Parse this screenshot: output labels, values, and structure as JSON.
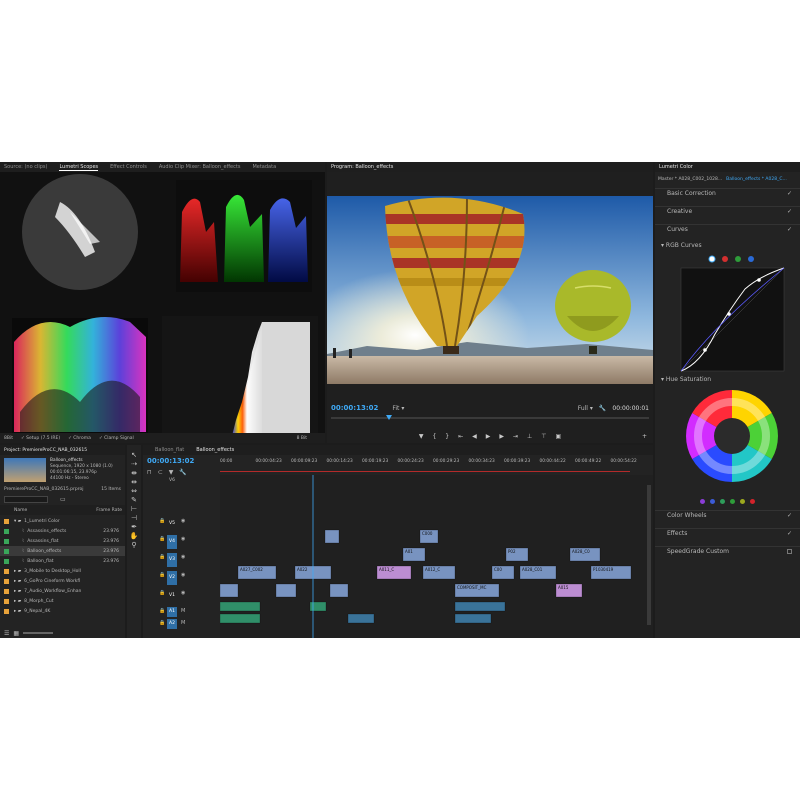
{
  "source_panel": {
    "tabs": [
      "Source: (no clips)",
      "Lumetri Scopes",
      "Effect Controls",
      "Audio Clip Mixer: Balloon_effects",
      "Metadata"
    ],
    "active_tab": "Lumetri Scopes",
    "bottom_bar": [
      "8Bit",
      "✓ Setup (7.5 IRE)",
      "✓ Chroma",
      "✓ Clamp Signal",
      "8 Bit"
    ]
  },
  "program": {
    "title": "Program: Balloon_effects",
    "timecode": "00:00:13:02",
    "fit": "Fit",
    "quality": "Full",
    "duration": "00:00:00:01",
    "wrench_icon": "wrench-icon",
    "transport_icons": [
      "marker-icon",
      "in-point-icon",
      "out-point-icon",
      "go-to-in-icon",
      "step-back-icon",
      "play-icon",
      "step-forward-icon",
      "go-to-out-icon",
      "lift-icon",
      "extract-icon",
      "export-frame-icon",
      "add-icon"
    ]
  },
  "lumetri": {
    "title": "Lumetri Color",
    "master": "Master * A028_C002_1028...",
    "clip": "Balloon_effects * A028_C...",
    "sections": {
      "basic": "Basic Correction",
      "creative": "Creative",
      "curves": "Curves",
      "rgb_curves": "RGB Curves",
      "hue_sat": "Hue Saturation",
      "color_wheels": "Color Wheels",
      "effects": "Effects",
      "speedgrade": "SpeedGrade Custom"
    },
    "curve_colors": [
      "#ffffff",
      "#d32f2f",
      "#2e9c3a",
      "#2a6ad6"
    ],
    "swatches": [
      "#8a3dd6",
      "#3c5bd6",
      "#2e9c5a",
      "#2e9c3a",
      "#9ca81e",
      "#d3232b"
    ]
  },
  "project": {
    "title": "Project: PremiereProCC_NAB_032615",
    "clip_name": "Balloon_effects",
    "clip_info": [
      "Sequence, 1920 x 1080 (1.0)",
      "00:01:06:15, 23.976p",
      "44100 Hz - Stereo"
    ],
    "project_file": "PremiereProCC_NAB_032615.prproj",
    "item_count": "15 Items",
    "columns": {
      "name": "Name",
      "rate": "Frame Rate"
    },
    "items": [
      {
        "name": "1_Lumetri Color",
        "rate": "",
        "color": "#e8a23a",
        "indent": 0,
        "type": "folder-open"
      },
      {
        "name": "Assassins_effects",
        "rate": "23.976",
        "color": "#3aa65a",
        "indent": 1,
        "type": "seq"
      },
      {
        "name": "Assassins_flat",
        "rate": "23.976",
        "color": "#3aa65a",
        "indent": 1,
        "type": "seq"
      },
      {
        "name": "Balloon_effects",
        "rate": "23.976",
        "color": "#3aa65a",
        "indent": 1,
        "type": "seq"
      },
      {
        "name": "Balloon_flat",
        "rate": "23.976",
        "color": "#3aa65a",
        "indent": 1,
        "type": "seq"
      },
      {
        "name": "3_Mobile to Desktop_Holl",
        "rate": "",
        "color": "#e8a23a",
        "indent": 0,
        "type": "folder"
      },
      {
        "name": "6_GoPro Cineform Workfl",
        "rate": "",
        "color": "#e8a23a",
        "indent": 0,
        "type": "folder"
      },
      {
        "name": "7_Audio_Workflow_Enhan",
        "rate": "",
        "color": "#e8a23a",
        "indent": 0,
        "type": "folder"
      },
      {
        "name": "8_Morph_Cut",
        "rate": "",
        "color": "#e8a23a",
        "indent": 0,
        "type": "folder"
      },
      {
        "name": "9_Nepal_4K",
        "rate": "",
        "color": "#e8a23a",
        "indent": 0,
        "type": "folder"
      }
    ]
  },
  "timeline": {
    "tabs": [
      "Balloon_flat",
      "Balloon_effects"
    ],
    "active_tab": "Balloon_effects",
    "timecode": "00:00:13:02",
    "ruler": [
      "00:00",
      "00:00:04:23",
      "00:00:09:23",
      "00:00:14:23",
      "00:00:19:23",
      "00:00:24:23",
      "00:00:29:23",
      "00:00:34:23",
      "00:00:39:23",
      "00:00:44:22",
      "00:00:49:22",
      "00:00:54:22"
    ],
    "v6_label": "V6",
    "tracks": [
      "V5",
      "V4",
      "V3",
      "V2",
      "V1",
      "A1",
      "A2"
    ],
    "clip_labels": [
      "A027_C002",
      "A022",
      "C000",
      "A01",
      "A011_C",
      "A012_C",
      "P02",
      "A028_C0",
      "A028_C0",
      "C00",
      "A028_C01",
      "P1030419",
      "COMPOSIT_MC",
      "A015"
    ]
  }
}
